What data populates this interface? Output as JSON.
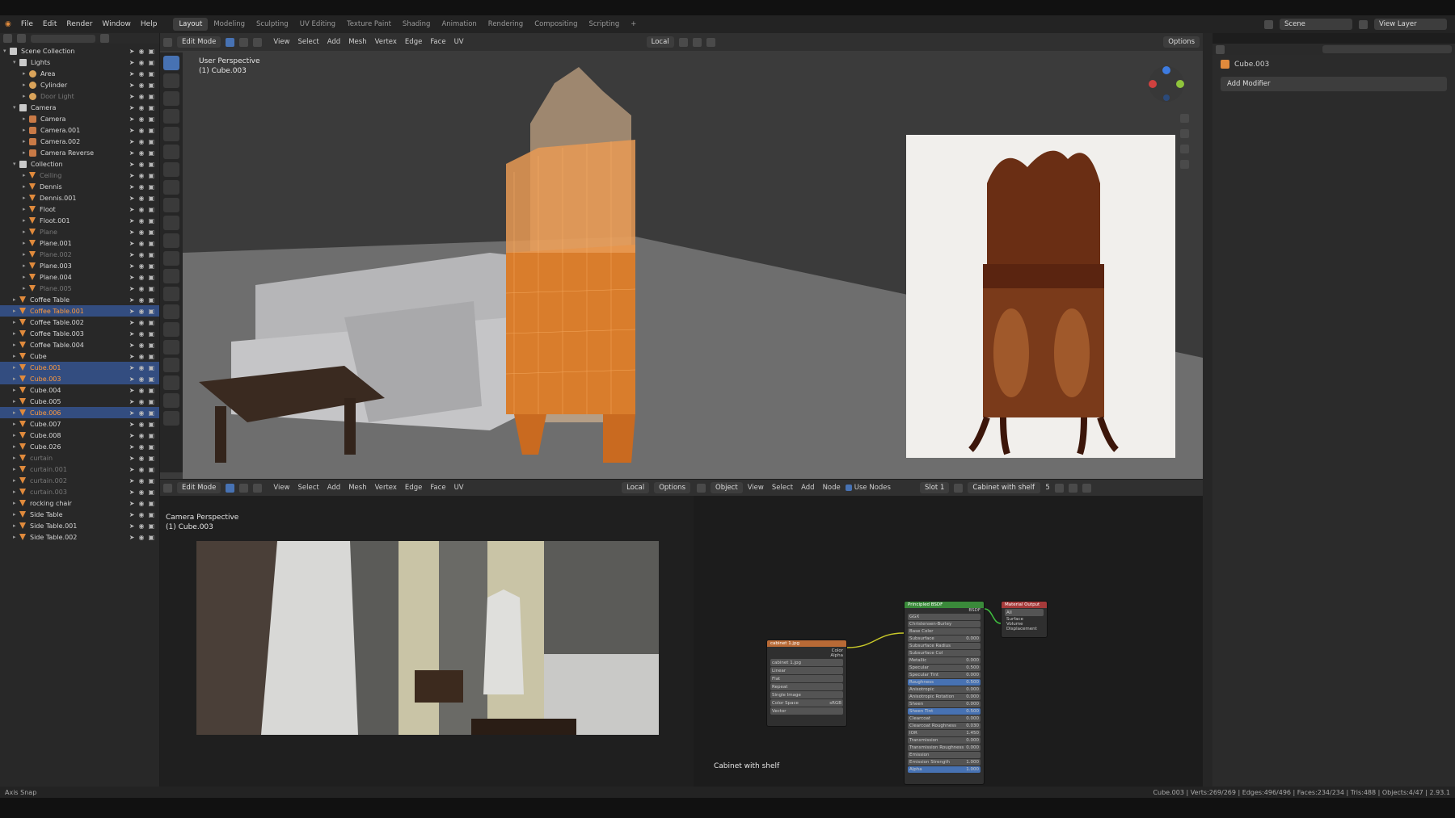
{
  "topbar": {
    "menus": [
      "File",
      "Edit",
      "Render",
      "Window",
      "Help"
    ],
    "workspaces": [
      "Layout",
      "Modeling",
      "Sculpting",
      "UV Editing",
      "Texture Paint",
      "Shading",
      "Animation",
      "Rendering",
      "Compositing",
      "Scripting",
      "+"
    ],
    "active_workspace": "Layout",
    "scene": "Scene",
    "view_layer": "View Layer"
  },
  "outliner": {
    "items": [
      {
        "label": "Scene Collection",
        "type": "col",
        "indent": 0,
        "state": ""
      },
      {
        "label": "Lights",
        "type": "col",
        "indent": 1,
        "state": ""
      },
      {
        "label": "Area",
        "type": "light",
        "indent": 2,
        "state": ""
      },
      {
        "label": "Cylinder",
        "type": "light",
        "indent": 2,
        "state": ""
      },
      {
        "label": "Door Light",
        "type": "light",
        "indent": 2,
        "state": "dim"
      },
      {
        "label": "Camera",
        "type": "col",
        "indent": 1,
        "state": ""
      },
      {
        "label": "Camera",
        "type": "cam",
        "indent": 2,
        "state": ""
      },
      {
        "label": "Camera.001",
        "type": "cam",
        "indent": 2,
        "state": ""
      },
      {
        "label": "Camera.002",
        "type": "cam",
        "indent": 2,
        "state": ""
      },
      {
        "label": "Camera Reverse",
        "type": "cam",
        "indent": 2,
        "state": ""
      },
      {
        "label": "Collection",
        "type": "col",
        "indent": 1,
        "state": ""
      },
      {
        "label": "Ceiling",
        "type": "mesh",
        "indent": 2,
        "state": "dim"
      },
      {
        "label": "Dennis",
        "type": "mesh",
        "indent": 2,
        "state": ""
      },
      {
        "label": "Dennis.001",
        "type": "mesh",
        "indent": 2,
        "state": ""
      },
      {
        "label": "Floot",
        "type": "mesh",
        "indent": 2,
        "state": ""
      },
      {
        "label": "Floot.001",
        "type": "mesh",
        "indent": 2,
        "state": ""
      },
      {
        "label": "Plane",
        "type": "mesh",
        "indent": 2,
        "state": "dim"
      },
      {
        "label": "Plane.001",
        "type": "mesh",
        "indent": 2,
        "state": ""
      },
      {
        "label": "Plane.002",
        "type": "mesh",
        "indent": 2,
        "state": "dim"
      },
      {
        "label": "Plane.003",
        "type": "mesh",
        "indent": 2,
        "state": ""
      },
      {
        "label": "Plane.004",
        "type": "mesh",
        "indent": 2,
        "state": ""
      },
      {
        "label": "Plane.005",
        "type": "mesh",
        "indent": 2,
        "state": "dim"
      },
      {
        "label": "Coffee Table",
        "type": "mesh",
        "indent": 1,
        "state": ""
      },
      {
        "label": "Coffee Table.001",
        "type": "mesh",
        "indent": 1,
        "state": "sel act"
      },
      {
        "label": "Coffee Table.002",
        "type": "mesh",
        "indent": 1,
        "state": ""
      },
      {
        "label": "Coffee Table.003",
        "type": "mesh",
        "indent": 1,
        "state": ""
      },
      {
        "label": "Coffee Table.004",
        "type": "mesh",
        "indent": 1,
        "state": ""
      },
      {
        "label": "Cube",
        "type": "mesh",
        "indent": 1,
        "state": ""
      },
      {
        "label": "Cube.001",
        "type": "mesh",
        "indent": 1,
        "state": "sel act"
      },
      {
        "label": "Cube.003",
        "type": "mesh",
        "indent": 1,
        "state": "sel act"
      },
      {
        "label": "Cube.004",
        "type": "mesh",
        "indent": 1,
        "state": ""
      },
      {
        "label": "Cube.005",
        "type": "mesh",
        "indent": 1,
        "state": ""
      },
      {
        "label": "Cube.006",
        "type": "mesh",
        "indent": 1,
        "state": "sel act"
      },
      {
        "label": "Cube.007",
        "type": "mesh",
        "indent": 1,
        "state": ""
      },
      {
        "label": "Cube.008",
        "type": "mesh",
        "indent": 1,
        "state": ""
      },
      {
        "label": "Cube.026",
        "type": "mesh",
        "indent": 1,
        "state": ""
      },
      {
        "label": "curtain",
        "type": "mesh",
        "indent": 1,
        "state": "dim"
      },
      {
        "label": "curtain.001",
        "type": "mesh",
        "indent": 1,
        "state": "dim"
      },
      {
        "label": "curtain.002",
        "type": "mesh",
        "indent": 1,
        "state": "dim"
      },
      {
        "label": "curtain.003",
        "type": "mesh",
        "indent": 1,
        "state": "dim"
      },
      {
        "label": "rocking chair",
        "type": "mesh",
        "indent": 1,
        "state": ""
      },
      {
        "label": "Side Table",
        "type": "mesh",
        "indent": 1,
        "state": ""
      },
      {
        "label": "Side Table.001",
        "type": "mesh",
        "indent": 1,
        "state": ""
      },
      {
        "label": "Side Table.002",
        "type": "mesh",
        "indent": 1,
        "state": ""
      }
    ]
  },
  "viewport_top": {
    "mode": "Edit Mode",
    "menus": [
      "View",
      "Select",
      "Add",
      "Mesh",
      "Vertex",
      "Edge",
      "Face",
      "UV"
    ],
    "transform_orientation": "Local",
    "options": "Options",
    "overlay_title": "User Perspective",
    "overlay_object": "(1) Cube.003"
  },
  "viewport_bottom": {
    "mode": "Edit Mode",
    "menus": [
      "View",
      "Select",
      "Add",
      "Mesh",
      "Vertex",
      "Edge",
      "Face",
      "UV"
    ],
    "transform_orientation": "Local",
    "options": "Options",
    "overlay_title": "Camera Perspective",
    "overlay_object": "(1) Cube.003"
  },
  "node_editor": {
    "object_mode": "Object",
    "menus": [
      "View",
      "Select",
      "Add",
      "Node"
    ],
    "use_nodes": "Use Nodes",
    "slot": "Slot 1",
    "material": "Cabinet with shelf",
    "users": "5",
    "footer_label": "Cabinet with shelf",
    "image_node": {
      "title": "cabinet 1.jpg",
      "rows": [
        "cabinet 1.jpg",
        "Linear",
        "Flat",
        "Repeat",
        "Single Image",
        "Color Space",
        "Vector"
      ],
      "color_space": "sRGB",
      "outputs": [
        "Color",
        "Alpha"
      ]
    },
    "bsdf_node": {
      "title": "Principled BSDF",
      "output": "BSDF",
      "rows": [
        "GGX",
        "Christensen-Burley",
        "Base Color",
        "Subsurface",
        "Subsurface Radius",
        "Subsurface Col",
        "Metallic",
        "Specular",
        "Specular Tint",
        "Roughness",
        "Anisotropic",
        "Anisotropic Rotation",
        "Sheen",
        "Sheen Tint",
        "Clearcoat",
        "Clearcoat Roughness",
        "IOR",
        "Transmission",
        "Transmission Roughness",
        "Emission",
        "Emission Strength",
        "Alpha"
      ],
      "values": [
        "",
        "",
        "",
        "0.000",
        "",
        "",
        "0.000",
        "0.500",
        "0.000",
        "0.500",
        "0.000",
        "0.000",
        "0.000",
        "0.500",
        "0.000",
        "0.030",
        "1.450",
        "0.000",
        "0.000",
        "",
        "1.000",
        "1.000"
      ]
    },
    "output_node": {
      "title": "Material Output",
      "target": "All",
      "rows": [
        "Surface",
        "Volume",
        "Displacement"
      ]
    }
  },
  "properties": {
    "object_name": "Cube.003",
    "add_modifier": "Add Modifier"
  },
  "status": {
    "left": "Axis Snap",
    "right": "Cube.003 | Verts:269/269 | Edges:496/496 | Faces:234/234 | Tris:488 | Objects:4/47 | 2.93.1"
  },
  "colors": {
    "selection": "#334d80",
    "active": "#ff9a3c",
    "accent": "#4772b3",
    "cabinet_orange": "#e08a3c"
  }
}
